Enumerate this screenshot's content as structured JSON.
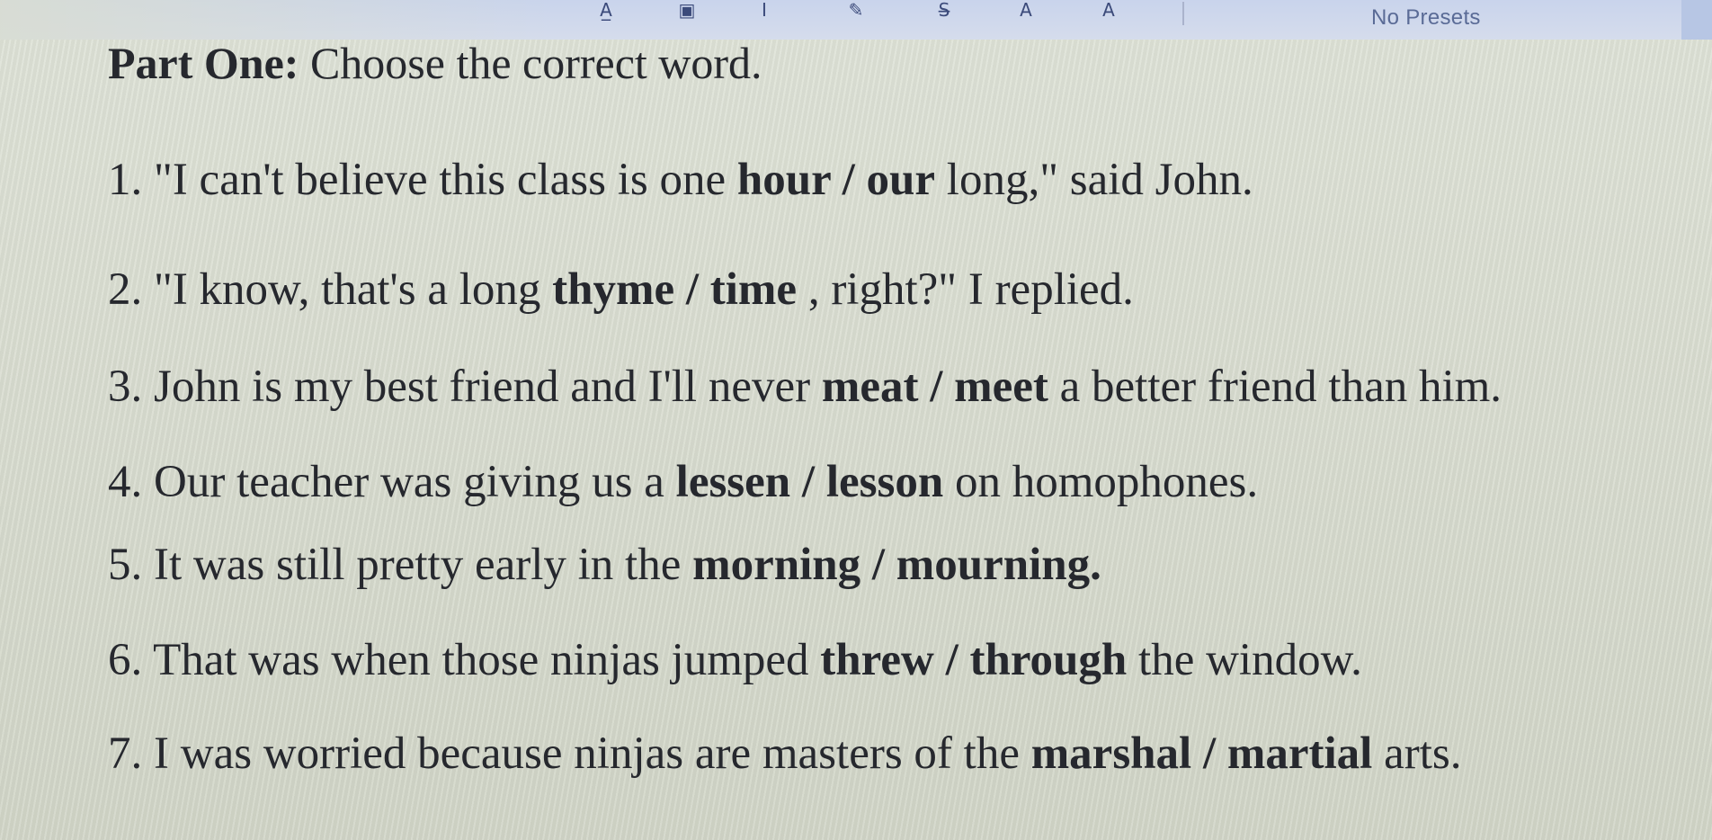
{
  "toolbar": {
    "tools": [
      {
        "icon": "underline-a-icon",
        "glyph": "A̲"
      },
      {
        "icon": "image-icon",
        "glyph": "▣"
      },
      {
        "icon": "text-cursor-icon",
        "glyph": "I"
      },
      {
        "icon": "highlighter-icon",
        "glyph": "✎"
      },
      {
        "icon": "strikethrough-icon",
        "glyph": "S̶"
      },
      {
        "icon": "text-a-icon",
        "glyph": "A"
      },
      {
        "icon": "text-a-strike-icon",
        "glyph": "A"
      }
    ],
    "presets_label": "No Presets"
  },
  "worksheet": {
    "heading_bold": "Part One:",
    "heading_rest": " Choose the correct word.",
    "items": [
      {
        "number": "1. ",
        "before": "\"I can't believe this class is one ",
        "choice": "hour / our",
        "after": " long,\" said John."
      },
      {
        "number": "2. ",
        "before": "\"I know, that's a long ",
        "choice": "thyme / time",
        "after": " , right?\" I replied."
      },
      {
        "number": "3. ",
        "before": "John is my best friend and I'll never ",
        "choice": "meat / meet",
        "after": " a better friend than him."
      },
      {
        "number": "4. ",
        "before": "Our teacher was giving us a ",
        "choice": "lessen / lesson",
        "after": " on homophones."
      },
      {
        "number": "5. ",
        "before": "It was still pretty early in the ",
        "choice": "morning / mourning.",
        "after": ""
      },
      {
        "number": "6. ",
        "before": "That was when those ninjas jumped ",
        "choice": "threw / through",
        "after": " the window."
      },
      {
        "number": "7. ",
        "before": "I was worried because ninjas are masters of the ",
        "choice": "marshal / martial",
        "after": " arts."
      }
    ]
  }
}
